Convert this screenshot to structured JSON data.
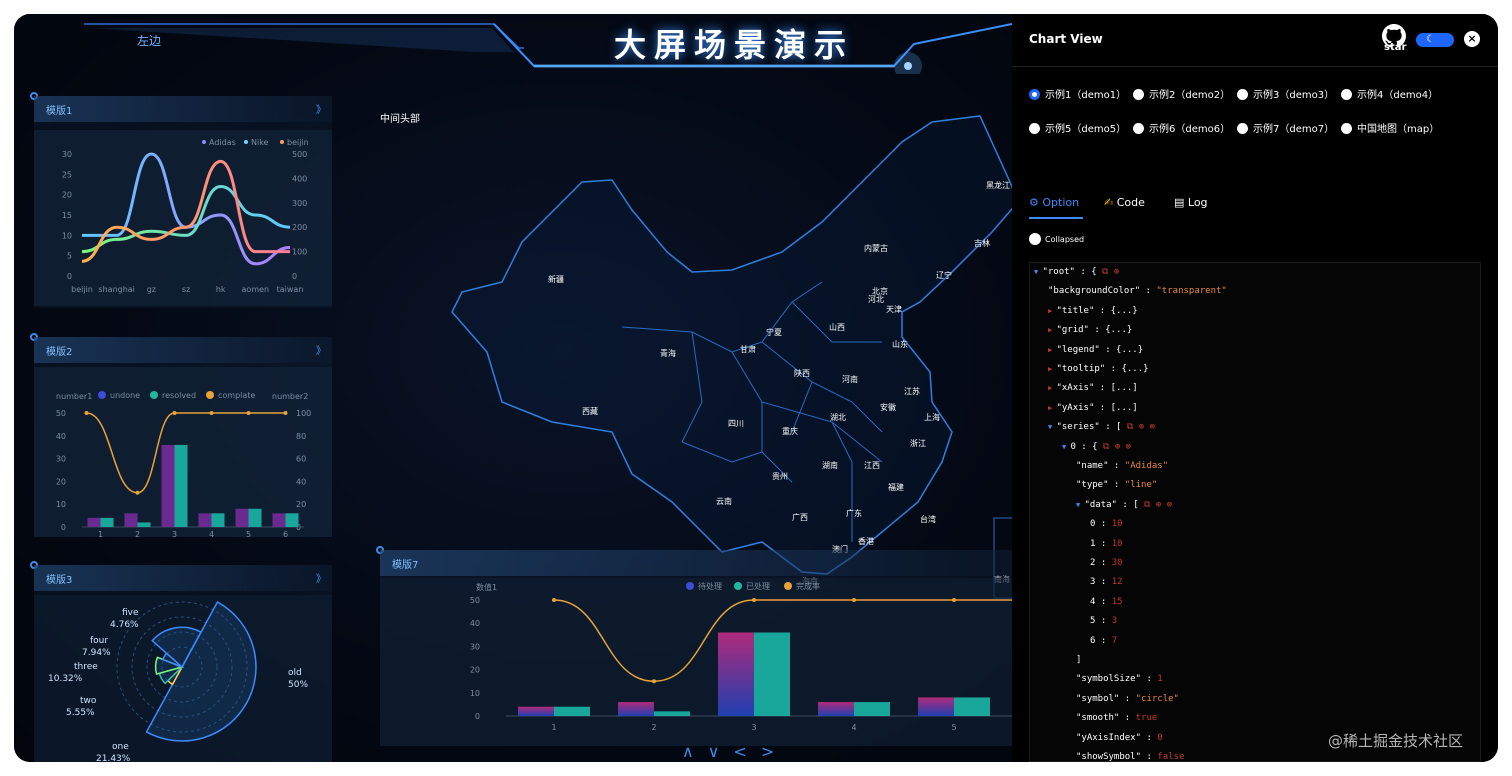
{
  "header": {
    "left_tab": "左边",
    "title": "大屏场景演示"
  },
  "panels": {
    "p1": {
      "title": "模版1",
      "arrow": "》",
      "chart": {
        "type": "line",
        "legend": [
          "Adidas",
          "Nike",
          "beijin"
        ],
        "categories": [
          "beijin",
          "shanghai",
          "gz",
          "sz",
          "hk",
          "aomen",
          "taiwan"
        ],
        "y_left": [
          "30",
          "25",
          "20",
          "15",
          "10",
          "5",
          "0"
        ],
        "y_right": [
          "500",
          "400",
          "300",
          "200",
          "100",
          "0"
        ]
      }
    },
    "p2": {
      "title": "模版2",
      "arrow": "》",
      "chart": {
        "type": "bar",
        "ylabel_left": "number1",
        "ylabel_right": "number2",
        "legend": [
          "undone",
          "resolved",
          "complate"
        ],
        "categories": [
          "1",
          "2",
          "3",
          "4",
          "5",
          "6"
        ],
        "y_left": [
          "50",
          "40",
          "30",
          "20",
          "10",
          "0"
        ],
        "y_right": [
          "100",
          "80",
          "60",
          "40",
          "20",
          "0"
        ]
      }
    },
    "p3": {
      "title": "模版3",
      "arrow": "》",
      "chart": {
        "type": "pie",
        "labels": [
          {
            "name": "five",
            "pct": "4.76%"
          },
          {
            "name": "four",
            "pct": "7.94%"
          },
          {
            "name": "three",
            "pct": "10.32%"
          },
          {
            "name": "two",
            "pct": "5.55%"
          },
          {
            "name": "one",
            "pct": "21.43%"
          },
          {
            "name": "old",
            "pct": "50%"
          }
        ]
      }
    },
    "p7": {
      "title": "模版7",
      "chart": {
        "type": "bar",
        "ylabel": "数值1",
        "legend": [
          "待处理",
          "已处理",
          "完成率"
        ],
        "categories": [
          "1",
          "2",
          "3",
          "4",
          "5"
        ],
        "y": [
          "50",
          "40",
          "30",
          "20",
          "10",
          "0"
        ]
      }
    }
  },
  "map": {
    "title": "中间头部",
    "provinces": [
      "黑龙江",
      "内蒙古",
      "吉林",
      "辽宁",
      "北京",
      "河北",
      "天津",
      "新疆",
      "宁夏",
      "山西",
      "山东",
      "青海",
      "甘肃",
      "陕西",
      "河南",
      "江苏",
      "西藏",
      "四川",
      "湖北",
      "安徽",
      "上海",
      "重庆",
      "浙江",
      "湖南",
      "江西",
      "贵州",
      "福建",
      "云南",
      "广西",
      "广东",
      "台湾",
      "澳门",
      "香港",
      "海南",
      "南海"
    ]
  },
  "chart_data": [
    {
      "type": "line",
      "title": "",
      "categories": [
        "beijin",
        "shanghai",
        "gz",
        "sz",
        "hk",
        "aomen",
        "taiwan"
      ],
      "series": [
        {
          "name": "Adidas",
          "values": [
            10,
            10,
            30,
            12,
            15,
            3,
            7
          ]
        },
        {
          "name": "Nike",
          "values": [
            6,
            9,
            11,
            10,
            22,
            15,
            12
          ]
        },
        {
          "name": "beijin",
          "values": [
            60,
            200,
            150,
            200,
            470,
            100,
            100
          ]
        }
      ],
      "ylim": [
        0,
        30
      ],
      "ylim_right": [
        0,
        500
      ]
    },
    {
      "type": "bar",
      "title": "",
      "categories": [
        "1",
        "2",
        "3",
        "4",
        "5",
        "6"
      ],
      "series": [
        {
          "name": "undone",
          "values": [
            4,
            6,
            36,
            6,
            8,
            6
          ]
        },
        {
          "name": "resolved",
          "values": [
            4,
            2,
            36,
            6,
            8,
            6
          ]
        },
        {
          "name": "complate",
          "values": [
            100,
            30,
            100,
            100,
            100,
            100
          ]
        }
      ],
      "ylim": [
        0,
        50
      ],
      "ylim_right": [
        0,
        100
      ]
    },
    {
      "type": "pie",
      "title": "",
      "series": [
        {
          "name": "five",
          "values": [
            4.76
          ]
        },
        {
          "name": "four",
          "values": [
            7.94
          ]
        },
        {
          "name": "three",
          "values": [
            10.32
          ]
        },
        {
          "name": "two",
          "values": [
            5.55
          ]
        },
        {
          "name": "one",
          "values": [
            21.43
          ]
        },
        {
          "name": "old",
          "values": [
            50
          ]
        }
      ]
    },
    {
      "type": "bar",
      "title": "",
      "categories": [
        "1",
        "2",
        "3",
        "4",
        "5"
      ],
      "series": [
        {
          "name": "待处理",
          "values": [
            4,
            6,
            36,
            6,
            8
          ]
        },
        {
          "name": "已处理",
          "values": [
            4,
            2,
            36,
            6,
            8
          ]
        },
        {
          "name": "完成率",
          "values": [
            100,
            30,
            100,
            100,
            100
          ]
        }
      ],
      "ylim": [
        0,
        50
      ]
    }
  ],
  "nav": {
    "arrows": "∧∨<>"
  },
  "right_panel": {
    "title": "Chart View",
    "star": "star",
    "close": "×",
    "radios": [
      "示例1（demo1）",
      "示例2（demo2）",
      "示例3（demo3）",
      "示例4（demo4）",
      "示例5（demo5）",
      "示例6（demo6）",
      "示例7（demo7）",
      "中国地图（map）"
    ],
    "tabs": [
      "Option",
      "Code",
      "Log"
    ],
    "collapsed": "Collapsed",
    "json_lines": [
      {
        "t": "tri",
        "k": "\"root\"",
        "v": " : {"
      },
      {
        "t": "kv",
        "k": "\"backgroundColor\"",
        "v": "\"transparent\"",
        "vt": "s"
      },
      {
        "t": "col",
        "k": "\"title\"",
        "v": " : {...}"
      },
      {
        "t": "col",
        "k": "\"grid\"",
        "v": " : {...}"
      },
      {
        "t": "col",
        "k": "\"legend\"",
        "v": " : {...}"
      },
      {
        "t": "col",
        "k": "\"tooltip\"",
        "v": " : {...}"
      },
      {
        "t": "col",
        "k": "\"xAxis\"",
        "v": " : [...]"
      },
      {
        "t": "col",
        "k": "\"yAxis\"",
        "v": " : [...]"
      },
      {
        "t": "tri",
        "k": "\"series\"",
        "v": " : ["
      },
      {
        "t": "tri",
        "k": "0",
        "v": " : {"
      },
      {
        "t": "kv",
        "k": "\"name\"",
        "v": "\"Adidas\"",
        "vt": "s"
      },
      {
        "t": "kv",
        "k": "\"type\"",
        "v": "\"line\"",
        "vt": "s"
      },
      {
        "t": "tri",
        "k": "\"data\"",
        "v": " : ["
      },
      {
        "t": "kv",
        "k": "0",
        "v": "10",
        "vt": "n"
      },
      {
        "t": "kv",
        "k": "1",
        "v": "10",
        "vt": "n"
      },
      {
        "t": "kv",
        "k": "2",
        "v": "30",
        "vt": "n"
      },
      {
        "t": "kv",
        "k": "3",
        "v": "12",
        "vt": "n"
      },
      {
        "t": "kv",
        "k": "4",
        "v": "15",
        "vt": "n"
      },
      {
        "t": "kv",
        "k": "5",
        "v": "3",
        "vt": "n"
      },
      {
        "t": "kv",
        "k": "6",
        "v": "7",
        "vt": "n"
      },
      {
        "t": "close",
        "k": "]",
        "v": ""
      },
      {
        "t": "kv",
        "k": "\"symbolSize\"",
        "v": "1",
        "vt": "n"
      },
      {
        "t": "kv",
        "k": "\"symbol\"",
        "v": "\"circle\"",
        "vt": "s"
      },
      {
        "t": "kv",
        "k": "\"smooth\"",
        "v": "true",
        "vt": "b"
      },
      {
        "t": "kv",
        "k": "\"yAxisIndex\"",
        "v": "0",
        "vt": "n"
      },
      {
        "t": "kv",
        "k": "\"showSymbol\"",
        "v": "false",
        "vt": "b"
      }
    ]
  },
  "watermark": "@稀土掘金技术社区",
  "colors": {
    "accent": "#1e66ff",
    "frame_bg": "#02050d",
    "panel_blue": "#3d8be8",
    "orange": "#e8a23a"
  }
}
